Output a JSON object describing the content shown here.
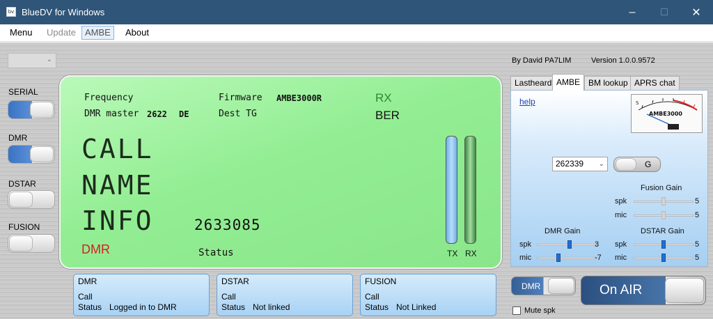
{
  "window": {
    "title": "BlueDV for Windows",
    "icon_text": "bv"
  },
  "menu": [
    "Menu",
    "Update",
    "AMBE",
    "About"
  ],
  "side": {
    "serial": "SERIAL",
    "dmr": "DMR",
    "dstar": "DSTAR",
    "fusion": "FUSION",
    "toggle_states": {
      "serial": "on",
      "dmr": "on",
      "dstar": "off",
      "fusion": "off"
    }
  },
  "lcd": {
    "frequency": "Frequency",
    "firmware_label": "Firmware",
    "firmware_value": "AMBE3000R",
    "rx": "RX",
    "master_label": "DMR master",
    "master_value": "2622",
    "master_suffix": "DE",
    "dest_tg": "Dest TG",
    "ber": "BER",
    "call": "CALL",
    "name": "NAME",
    "info": "INFO",
    "id": "2633085",
    "mode": "DMR",
    "status": "Status",
    "tx_label": "TX",
    "rx_label": "RX"
  },
  "boxes": [
    {
      "title": "DMR",
      "call": "Call",
      "status_label": "Status",
      "status_value": "Logged in to DMR"
    },
    {
      "title": "DSTAR",
      "call": "Call",
      "status_label": "Status",
      "status_value": "Not linked"
    },
    {
      "title": "FUSION",
      "call": "Call",
      "status_label": "Status",
      "status_value": "Not Linked"
    }
  ],
  "right": {
    "byline": "By David PA7LIM",
    "version": "Version 1.0.0.9572",
    "tabs": [
      "Lastheard",
      "AMBE",
      "BM lookup",
      "APRS chat"
    ],
    "active_tab": "AMBE",
    "help": "help",
    "meter_label": "AMBE3000",
    "tg_value": "262339",
    "g_label": "G",
    "fusion_gain": {
      "title": "Fusion Gain",
      "spk": "spk",
      "mic": "mic",
      "spk_value": "5",
      "mic_value": "5"
    },
    "dmr_gain": {
      "title": "DMR Gain",
      "spk": "spk",
      "mic": "mic",
      "spk_value": "3",
      "mic_value": "-7"
    },
    "dstar_gain": {
      "title": "DSTAR Gain",
      "spk": "spk",
      "mic": "mic",
      "spk_value": "5",
      "mic_value": "5"
    },
    "dmr_toggle": "DMR",
    "onair": "On AIR",
    "mute": "Mute spk"
  },
  "colors": {
    "titlebar": "#2f5578",
    "lcd_green": "#93ee93",
    "mode_red": "#d32020",
    "rx_green": "#2c8a2c"
  }
}
